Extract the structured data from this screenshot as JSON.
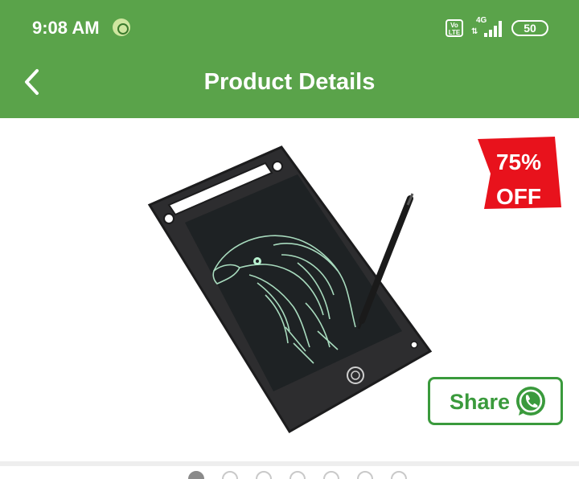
{
  "status_bar": {
    "time": "9:08 AM",
    "volte": "Vo LTE",
    "network": "4G",
    "battery": "50"
  },
  "header": {
    "title": "Product Details",
    "back_icon": "chevron-left-icon",
    "background_color": "#5aa34a"
  },
  "product": {
    "discount_badge": "75% OFF",
    "discount_color": "#e8121c"
  },
  "share": {
    "label": "Share",
    "icon": "whatsapp-icon",
    "accent_color": "#3a9a3c"
  },
  "carousel": {
    "total": 7,
    "active_index": 0
  }
}
